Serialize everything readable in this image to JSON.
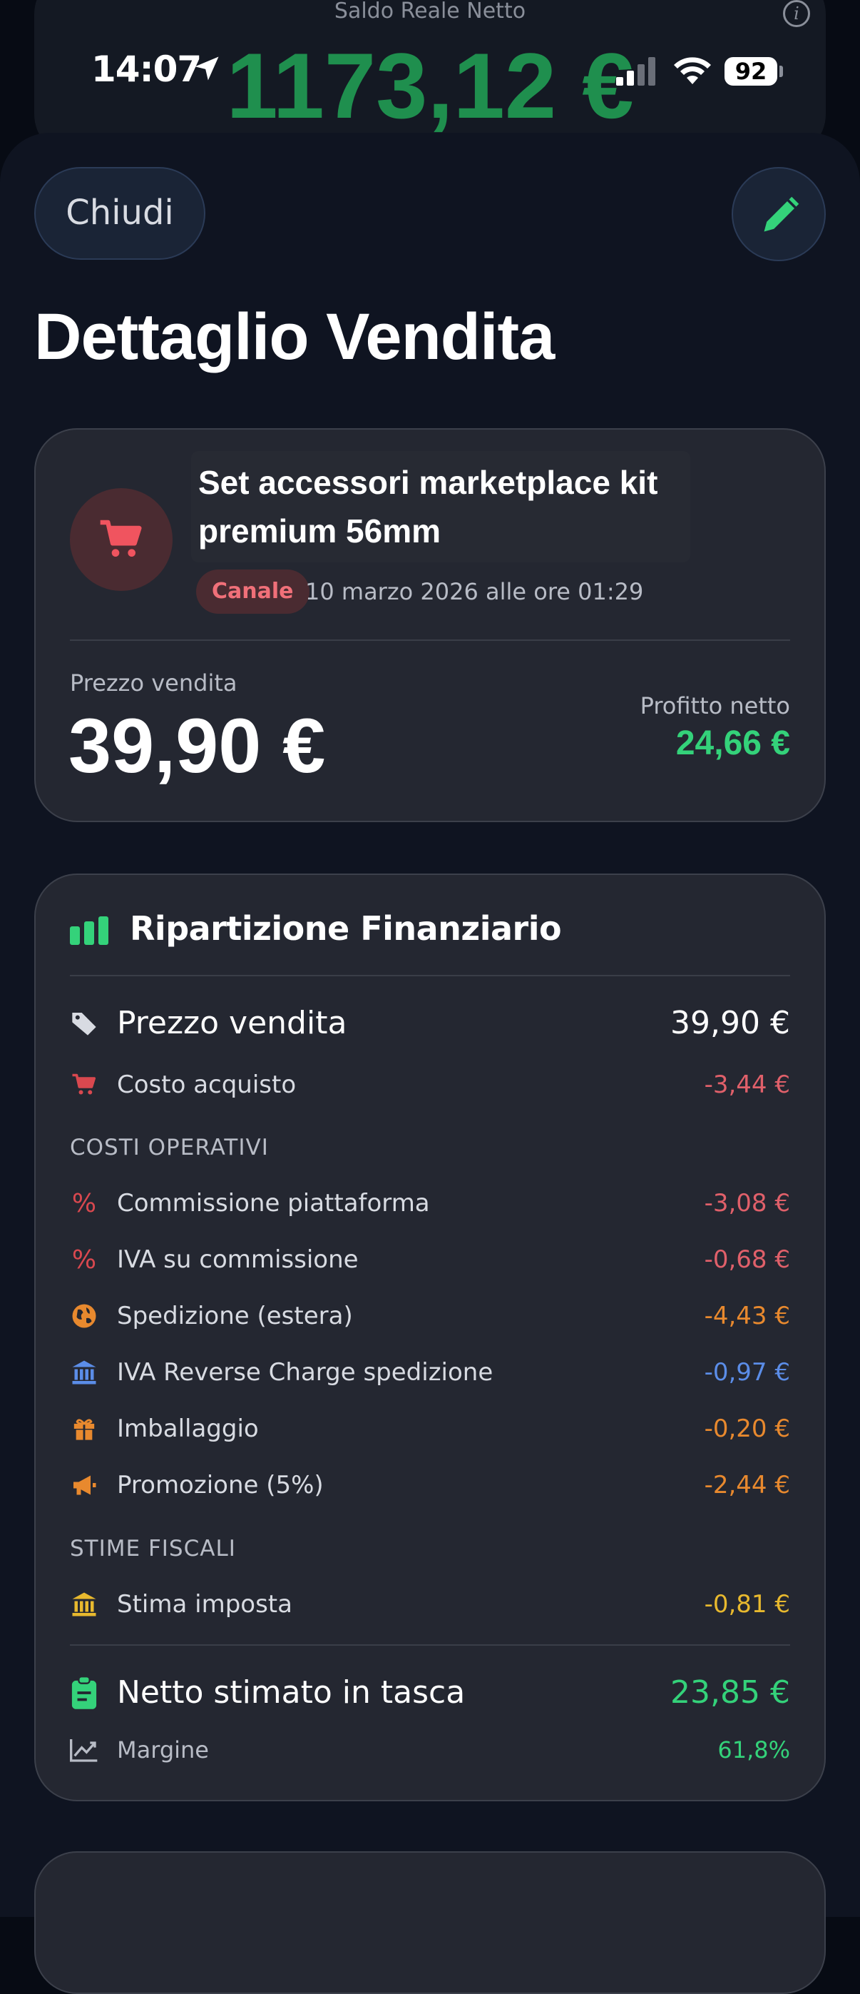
{
  "status_bar": {
    "time": "14:07",
    "battery": "92"
  },
  "background": {
    "title": "Saldo Reale Netto",
    "amount": "1173,12 €"
  },
  "header": {
    "close_label": "Chiudi",
    "page_title": "Dettaglio Vendita"
  },
  "sale": {
    "title": "Set accessori marketplace kit premium 56mm",
    "channel": "Canale",
    "date": "10 marzo 2026 alle ore 01:29",
    "price_label": "Prezzo vendita",
    "price": "39,90 €",
    "profit_label": "Profitto netto",
    "profit": "24,66 €"
  },
  "breakdown": {
    "title": "Ripartizione Finanziario",
    "sale_price": {
      "label": "Prezzo vendita",
      "value": "39,90 €"
    },
    "purchase_cost": {
      "label": "Costo acquisto",
      "value": "-3,44 €"
    },
    "operating_section": "COSTI OPERATIVI",
    "operating": [
      {
        "icon": "percent-icon",
        "label": "Commissione piattaforma",
        "value": "-3,08 €",
        "color": "#e0606a"
      },
      {
        "icon": "percent-icon",
        "label": "IVA su commissione",
        "value": "-0,68 €",
        "color": "#e0606a"
      },
      {
        "icon": "globe-icon",
        "label": "Spedizione (estera)",
        "value": "-4,43 €",
        "color": "#e8892e"
      },
      {
        "icon": "bank-icon",
        "label": "IVA Reverse Charge spedizione",
        "value": "-0,97 €",
        "color": "#5b8de8"
      },
      {
        "icon": "gift-icon",
        "label": "Imballaggio",
        "value": "-0,20 €",
        "color": "#e8892e"
      },
      {
        "icon": "megaphone-icon",
        "label": "Promozione (5%)",
        "value": "-2,44 €",
        "color": "#e8892e"
      }
    ],
    "tax_section": "STIME FISCALI",
    "tax_estimate": {
      "label": "Stima imposta",
      "value": "-0,81 €",
      "color": "#e8b92e"
    },
    "net": {
      "label": "Netto stimato in tasca",
      "value": "23,85 €",
      "color": "#34d27a"
    },
    "margin": {
      "label": "Margine",
      "value": "61,8%"
    }
  }
}
